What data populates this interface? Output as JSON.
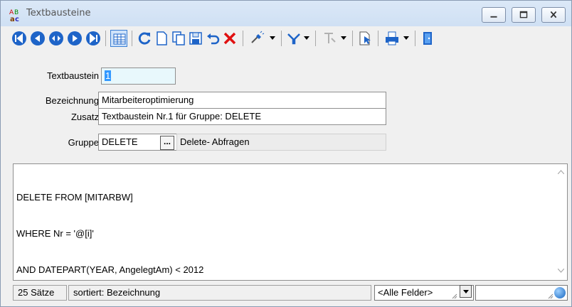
{
  "window": {
    "title": "Textbausteine"
  },
  "form": {
    "textbaustein_label": "Textbaustein",
    "textbaustein_value": "1",
    "bezeichnung_label": "Bezeichnung",
    "bezeichnung_value": "Mitarbeiteroptimierung",
    "zusatz_label": "Zusatz",
    "zusatz_value": "Textbaustein Nr.1 für Gruppe: DELETE",
    "gruppe_label": "Gruppe",
    "gruppe_value": "DELETE",
    "gruppe_button": "...",
    "gruppe_description": "Delete- Abfragen"
  },
  "editor": {
    "lines": [
      "DELETE FROM [MITARBW]",
      "WHERE Nr = '@[i]'",
      "AND DATEPART(YEAR, AngelegtAm) < 2012"
    ]
  },
  "status": {
    "count": "25 Sätze",
    "sorted": "sortiert: Bezeichnung",
    "field_filter": "<Alle Felder>",
    "search_value": ""
  },
  "colors": {
    "nav_blue": "#1e64c8",
    "delete_red": "#e01010",
    "title_bar": "#d4e4f6"
  }
}
